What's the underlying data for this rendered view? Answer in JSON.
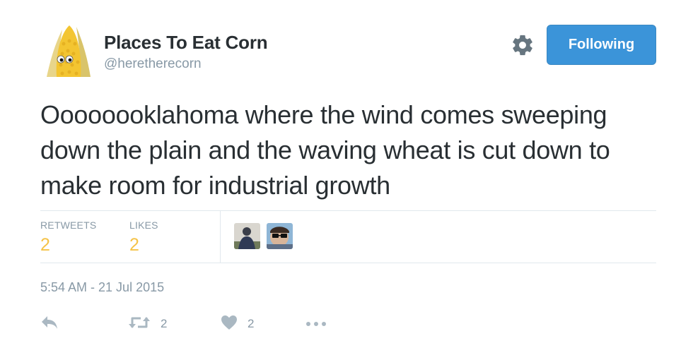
{
  "user": {
    "name": "Places To Eat Corn",
    "handle": "@heretherecorn"
  },
  "header": {
    "follow_label": "Following",
    "settings_icon": "gear-icon"
  },
  "tweet": {
    "text": "Oooooooklahoma where the wind comes sweeping down the plain and the waving wheat is cut down to make room for industrial growth",
    "timestamp": "5:54 AM - 21 Jul 2015"
  },
  "stats": {
    "retweets_label": "RETWEETS",
    "retweets_value": "2",
    "likes_label": "LIKES",
    "likes_value": "2"
  },
  "actions": {
    "reply_icon": "reply-icon",
    "retweet_icon": "retweet-icon",
    "retweet_count": "2",
    "like_icon": "heart-icon",
    "like_count": "2",
    "more_icon": "more-icon"
  },
  "colors": {
    "accent": "#3b94d9",
    "stat_value": "#f5c348",
    "muted": "#8899a6",
    "text": "#292f33"
  }
}
